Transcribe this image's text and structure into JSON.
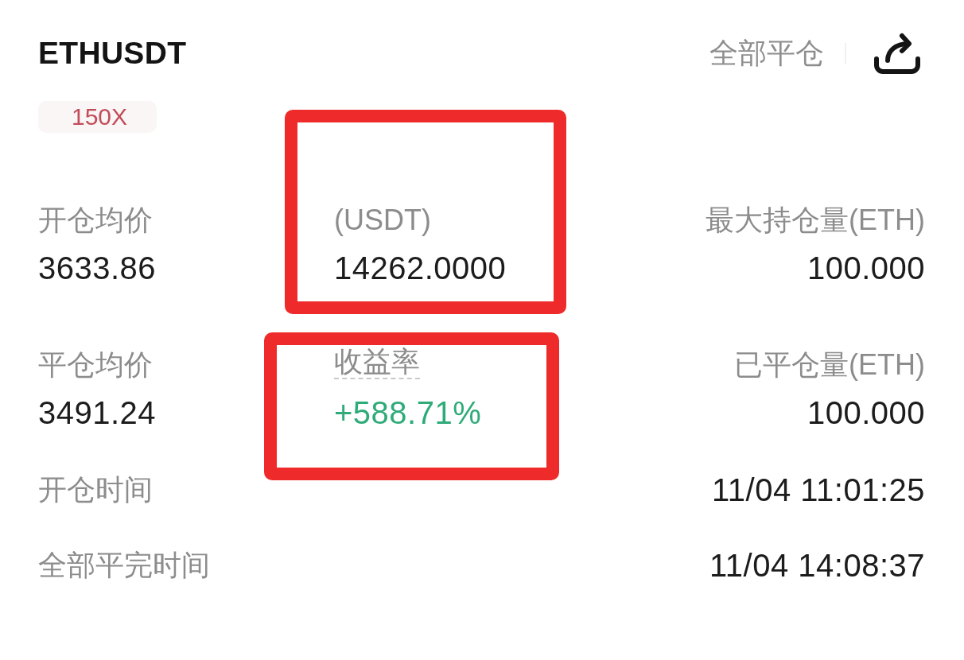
{
  "header": {
    "symbol": "ETHUSDT",
    "close_all_button": "全部平仓"
  },
  "leverage_tag": "150X",
  "stat_rows": [
    {
      "cells": [
        {
          "label": "开仓均价",
          "value": "3633.86",
          "kind": "plain",
          "highlighted": false
        },
        {
          "label": "(USDT)",
          "value": "14262.0000",
          "kind": "plain",
          "highlighted": true
        },
        {
          "label": "最大持仓量(ETH)",
          "value": "100.000",
          "kind": "plain",
          "highlighted": false
        }
      ]
    },
    {
      "cells": [
        {
          "label": "平仓均价",
          "value": "3491.24",
          "kind": "plain",
          "highlighted": false
        },
        {
          "label": "收益率",
          "value": "+588.71%",
          "kind": "rate",
          "highlighted": true
        },
        {
          "label": "已平仓量(ETH)",
          "value": "100.000",
          "kind": "plain",
          "highlighted": false
        }
      ]
    }
  ],
  "time_rows": [
    {
      "label": "开仓时间",
      "value": "11/04 11:01:25"
    },
    {
      "label": "全部平完时间",
      "value": "11/04 14:08:37"
    }
  ]
}
